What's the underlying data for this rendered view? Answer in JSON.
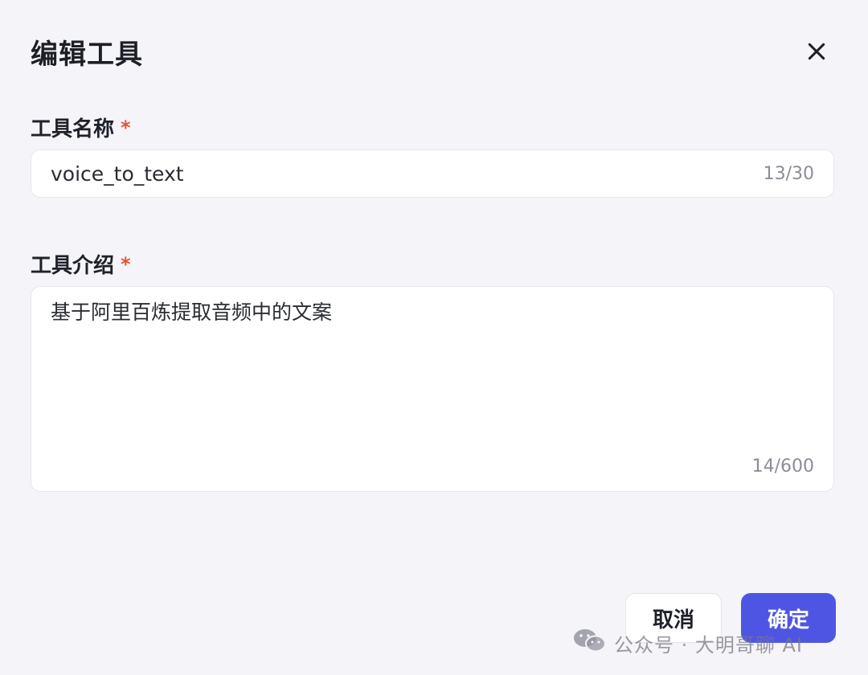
{
  "dialog": {
    "title": "编辑工具",
    "close_icon": "close-icon"
  },
  "fields": {
    "name": {
      "label": "工具名称",
      "required_mark": "*",
      "value": "voice_to_text",
      "counter": "13/30"
    },
    "description": {
      "label": "工具介绍",
      "required_mark": "*",
      "value": "基于阿里百炼提取音频中的文案",
      "counter": "14/600"
    }
  },
  "actions": {
    "cancel_label": "取消",
    "confirm_label": "确定"
  },
  "watermark": {
    "icon": "wechat-icon",
    "text": "公众号 · 大明哥聊 AI"
  },
  "colors": {
    "background": "#f4f4f9",
    "primary": "#4f55e3",
    "required": "#e4562f"
  }
}
